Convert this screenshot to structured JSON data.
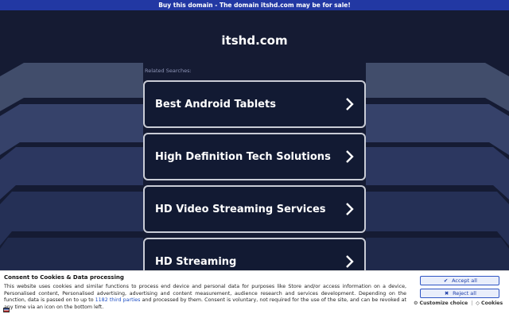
{
  "topbar": {
    "text": "Buy this domain - The domain itshd.com may be for sale!"
  },
  "header": {
    "domain": "itshd.com"
  },
  "related": {
    "label": "Related Searches:",
    "items": [
      {
        "label": "Best Android Tablets"
      },
      {
        "label": "High Definition Tech Solutions"
      },
      {
        "label": "HD Video Streaming Services"
      },
      {
        "label": "HD Streaming"
      }
    ]
  },
  "consent": {
    "title": "Consent to Cookies & Data processing",
    "text_before_link": "This website uses cookies and similar functions to process end device and personal data for purposes like Store and/or access information on a device, Personalised content, Personalised advertising, advertising and content measurement, audience research and services development. Depending on the function, data is passed on to up to ",
    "link": "1182 third parties",
    "text_after_link": " and processed by them. Consent is voluntary, not required for the use of the site, and can be revoked at any time via an icon on the bottom left.",
    "accept_label": "Accept all",
    "reject_label": "Reject all",
    "customize_label": "Customize choice",
    "cookies_label": "Cookies"
  },
  "colors": {
    "background": "#151b33",
    "topbar": "#2238a3",
    "card_border": "#c9ccd6",
    "button_border": "#2f55c4"
  }
}
